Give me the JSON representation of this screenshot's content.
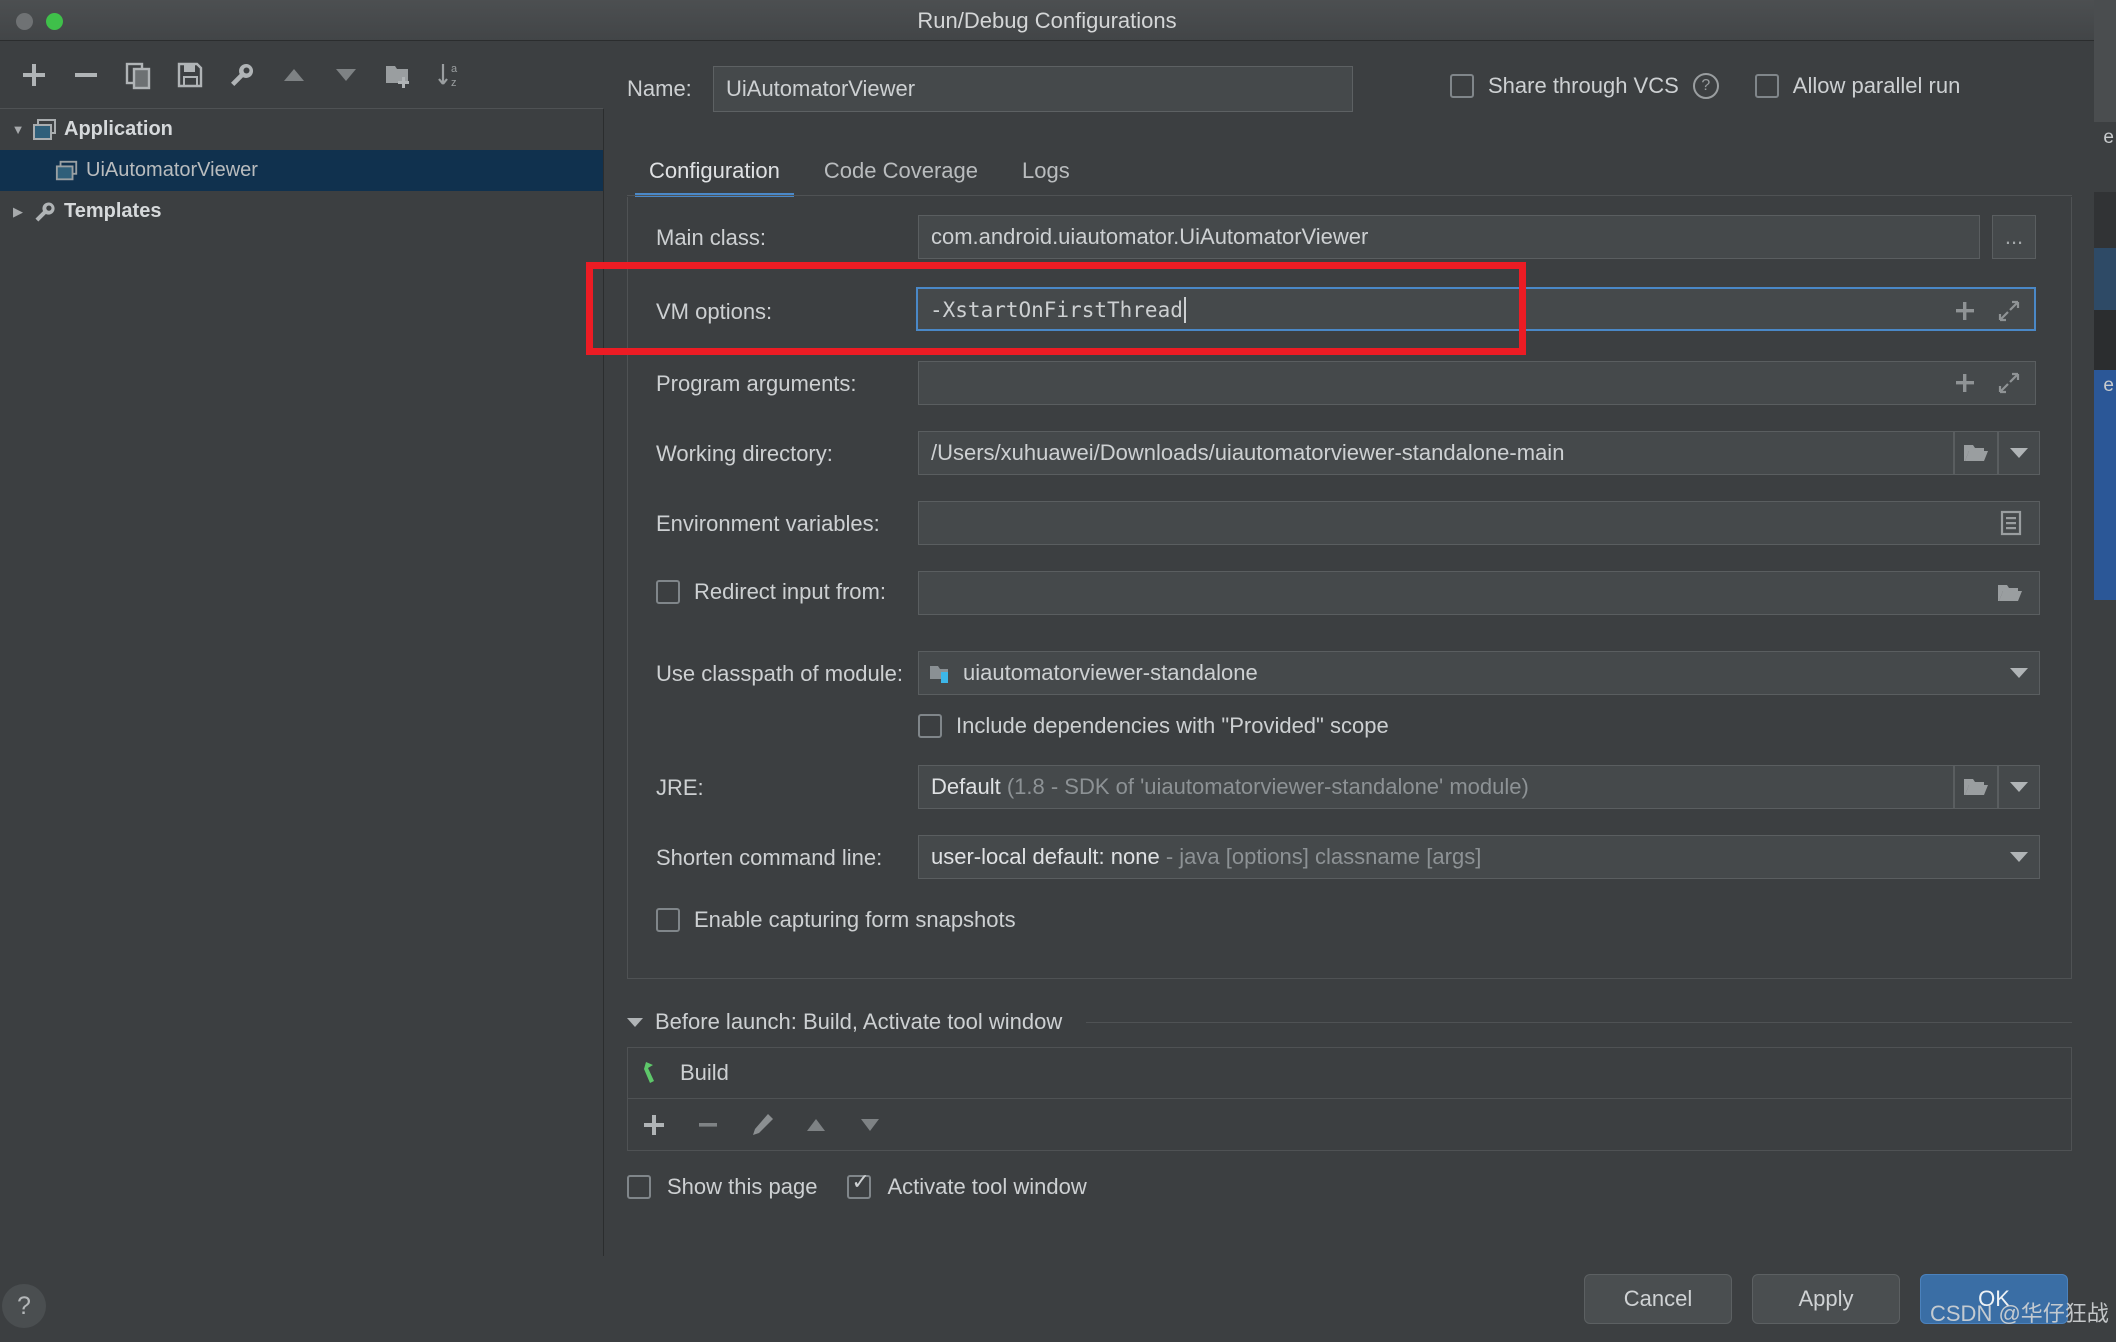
{
  "window": {
    "title": "Run/Debug Configurations"
  },
  "left_toolbar": {
    "buttons": [
      {
        "name": "add",
        "icon": "plus-icon"
      },
      {
        "name": "remove",
        "icon": "minus-icon"
      },
      {
        "name": "copy",
        "icon": "copy-icon"
      },
      {
        "name": "save",
        "icon": "save-icon"
      },
      {
        "name": "edit-templates",
        "icon": "wrench-icon"
      },
      {
        "name": "move-up",
        "icon": "arrow-up-icon"
      },
      {
        "name": "move-down",
        "icon": "arrow-down-icon"
      },
      {
        "name": "new-folder",
        "icon": "folder-add-icon"
      },
      {
        "name": "sort-alphabetically",
        "icon": "sort-az-icon"
      }
    ]
  },
  "tree": {
    "items": [
      {
        "label": "Application",
        "icon": "application-icon",
        "arrow": "▼",
        "bold": true,
        "selected": false,
        "child": false
      },
      {
        "label": "UiAutomatorViewer",
        "icon": "application-icon",
        "arrow": "",
        "bold": false,
        "selected": true,
        "child": true
      },
      {
        "label": "Templates",
        "icon": "wrench-icon",
        "arrow": "▶",
        "bold": true,
        "selected": false,
        "child": false
      }
    ]
  },
  "help_button": "?",
  "name_row": {
    "label": "Name:",
    "value": "UiAutomatorViewer",
    "share_through_vcs": "Share through VCS",
    "share_checked": false,
    "help_glyph": "?",
    "allow_parallel_run": "Allow parallel run",
    "allow_parallel_checked": false
  },
  "tabs": [
    {
      "label": "Configuration",
      "active": true
    },
    {
      "label": "Code Coverage",
      "active": false
    },
    {
      "label": "Logs",
      "active": false
    }
  ],
  "fields": {
    "main_class": {
      "label": "Main class:",
      "value": "com.android.uiautomator.UiAutomatorViewer",
      "browse_button": "..."
    },
    "vm_options": {
      "label": "VM options:",
      "value": "-XstartOnFirstThread",
      "focused": true,
      "expand_icon": "expand-icon",
      "insert_icon": "plus-icon"
    },
    "program_arguments": {
      "label": "Program arguments:",
      "value": "",
      "expand_icon": "expand-icon",
      "insert_icon": "plus-icon"
    },
    "working_directory": {
      "label": "Working directory:",
      "value": "/Users/xuhuawei/Downloads/uiautomatorviewer-standalone-main",
      "browse_icon": "folder-icon",
      "dropdown_icon": "chevron-down-icon"
    },
    "environment_variables": {
      "label": "Environment variables:",
      "value": "",
      "editor_icon": "list-edit-icon"
    },
    "redirect_input": {
      "label": "Redirect input from:",
      "checked": false,
      "value": "",
      "browse_icon": "folder-icon"
    },
    "use_classpath": {
      "label": "Use classpath of module:",
      "value": "uiautomatorviewer-standalone",
      "module_icon": "module-icon",
      "dropdown_icon": "chevron-down-icon"
    },
    "include_dependencies": {
      "label": "Include dependencies with \"Provided\" scope",
      "checked": false
    },
    "jre": {
      "label": "JRE:",
      "value_bright": "Default",
      "value_dim": "(1.8 - SDK of 'uiautomatorviewer-standalone' module)",
      "browse_icon": "folder-icon",
      "dropdown_icon": "chevron-down-icon"
    },
    "shorten_command_line": {
      "label": "Shorten command line:",
      "value_bright": "user-local default: none",
      "value_dim": "- java [options] classname [args]",
      "dropdown_icon": "chevron-down-icon"
    },
    "enable_capturing": {
      "label": "Enable capturing form snapshots",
      "checked": false
    }
  },
  "before_launch": {
    "title": "Before launch: Build, Activate tool window",
    "collapse_arrow": "▼",
    "items": [
      {
        "label": "Build",
        "icon": "build-hammer-icon"
      }
    ],
    "toolbar": [
      {
        "name": "add",
        "icon": "plus-icon"
      },
      {
        "name": "remove",
        "icon": "minus-icon"
      },
      {
        "name": "edit",
        "icon": "pencil-icon"
      },
      {
        "name": "move-up",
        "icon": "arrow-up-icon"
      },
      {
        "name": "move-down",
        "icon": "arrow-down-icon"
      }
    ],
    "show_this_page": {
      "label": "Show this page",
      "checked": false
    },
    "activate_tool_window": {
      "label": "Activate tool window",
      "checked": true
    }
  },
  "footer": {
    "cancel": "Cancel",
    "apply": "Apply",
    "ok": "OK"
  },
  "watermark": "CSDN @华仔狂战",
  "colors": {
    "accent": "#4a88c7",
    "selection": "#10314e",
    "annotation": "#ec1c24",
    "ok_button": "#3a6ea5",
    "background": "#3c3f41"
  }
}
